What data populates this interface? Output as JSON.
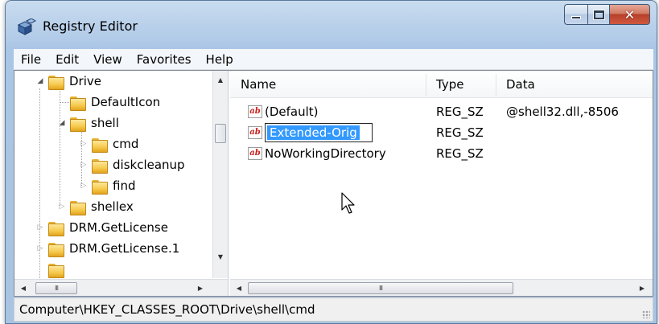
{
  "window": {
    "title": "Registry Editor",
    "app_icon": "registry-cube-icon",
    "caption_buttons": [
      "minimize-icon",
      "maximize-icon",
      "close-icon"
    ]
  },
  "menu": [
    "File",
    "Edit",
    "View",
    "Favorites",
    "Help"
  ],
  "tree": {
    "items": [
      {
        "label": "Drive",
        "expander": "expanded"
      },
      {
        "label": "DefaultIcon",
        "expander": "none"
      },
      {
        "label": "shell",
        "expander": "expanded"
      },
      {
        "label": "cmd",
        "expander": "collapsed"
      },
      {
        "label": "diskcleanup",
        "expander": "collapsed"
      },
      {
        "label": "find",
        "expander": "collapsed"
      },
      {
        "label": "shellex",
        "expander": "collapsed"
      },
      {
        "label": "DRM.GetLicense",
        "expander": "collapsed"
      },
      {
        "label": "DRM.GetLicense.1",
        "expander": "collapsed"
      }
    ],
    "hscroll_thumb": "III"
  },
  "list": {
    "columns": [
      "Name",
      "Type",
      "Data"
    ],
    "rows": [
      {
        "name": "(Default)",
        "type": "REG_SZ",
        "data": "@shell32.dll,-8506",
        "icon": "string-value-icon"
      },
      {
        "name": "Extended-Orig",
        "type": "REG_SZ",
        "data": "",
        "icon": "string-value-icon",
        "editing": true
      },
      {
        "name": "NoWorkingDirectory",
        "type": "REG_SZ",
        "data": "",
        "icon": "string-value-icon"
      }
    ],
    "icon_text": "ab",
    "hscroll_thumb": "III"
  },
  "status": {
    "path": "Computer\\HKEY_CLASSES_ROOT\\Drive\\shell\\cmd"
  },
  "colors": {
    "selection": "#3399ff",
    "folder": "#f5c84b",
    "close_button": "#c94a33",
    "frame": "#aac6e6"
  }
}
